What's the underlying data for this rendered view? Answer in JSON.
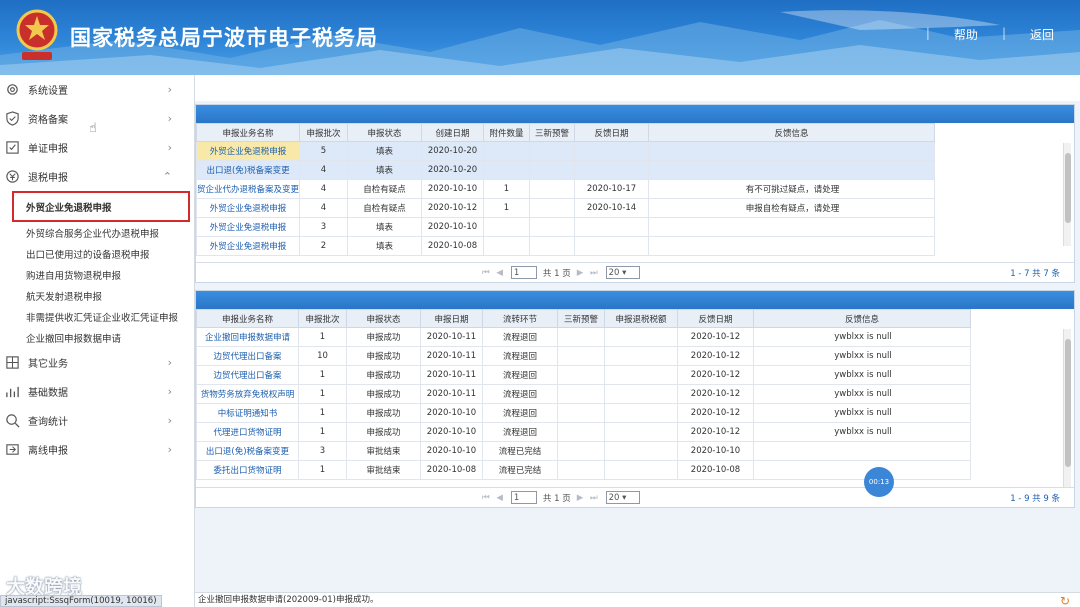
{
  "header": {
    "title": "国家税务总局宁波市电子税务局",
    "help_label": "帮助",
    "back_label": "返回",
    "separator": "|"
  },
  "sidebar": {
    "items": [
      {
        "label": "系统设置",
        "icon": "gear-icon",
        "chevron": "›"
      },
      {
        "label": "资格备案",
        "icon": "shield-icon",
        "chevron": "›"
      },
      {
        "label": "单证申报",
        "icon": "document-icon",
        "chevron": "›"
      },
      {
        "label": "退税申报",
        "icon": "refund-icon",
        "chevron": "⌃"
      }
    ],
    "sub_items": [
      "外贸企业免退税申报",
      "外贸综合服务企业代办退税申报",
      "出口已使用过的设备退税申报",
      "购进自用货物退税申报",
      "航天发射退税申报",
      "非需提供收汇凭证企业收汇凭证申报",
      "企业撤回申报数据申请"
    ],
    "items_after": [
      {
        "label": "其它业务",
        "icon": "grid-icon",
        "chevron": "›"
      },
      {
        "label": "基础数据",
        "icon": "chart-icon",
        "chevron": "›"
      },
      {
        "label": "查询统计",
        "icon": "search-icon",
        "chevron": "›"
      },
      {
        "label": "离线申报",
        "icon": "offline-icon",
        "chevron": "›"
      }
    ]
  },
  "table1": {
    "headers": [
      "申报业务名称",
      "申报批次",
      "申报状态",
      "创建日期",
      "附件数量",
      "三新预警",
      "反馈日期",
      "反馈信息"
    ],
    "rows": [
      [
        "外贸企业免退税申报",
        "5",
        "填表",
        "2020-10-20",
        "",
        "",
        "",
        ""
      ],
      [
        "出口退(免)税备案变更",
        "4",
        "填表",
        "2020-10-20",
        "",
        "",
        "",
        ""
      ],
      [
        "贸企业代办退税备案及变更",
        "4",
        "自检有疑点",
        "2020-10-10",
        "1",
        "",
        "2020-10-17",
        "有不可挑过疑点，请处理"
      ],
      [
        "外贸企业免退税申报",
        "4",
        "自检有疑点",
        "2020-10-12",
        "1",
        "",
        "2020-10-14",
        "申报自检有疑点，请处理"
      ],
      [
        "外贸企业免退税申报",
        "3",
        "填表",
        "2020-10-10",
        "",
        "",
        "",
        ""
      ],
      [
        "外贸企业免退税申报",
        "2",
        "填表",
        "2020-10-08",
        "",
        "",
        "",
        ""
      ]
    ],
    "pager": {
      "arrows_prev": "⏮ ◀",
      "page": "1",
      "of": "共 1 页",
      "arrows_next": "▶ ⏭",
      "page_size": "20",
      "total": "1 - 7  共 7 条"
    }
  },
  "table2": {
    "headers": [
      "申报业务名称",
      "申报批次",
      "申报状态",
      "申报日期",
      "流转环节",
      "三新预警",
      "申报退税税额",
      "反馈日期",
      "反馈信息"
    ],
    "rows": [
      [
        "企业撤回申报数据申请",
        "1",
        "申报成功",
        "2020-10-11",
        "流程退回",
        "",
        "",
        "2020-10-12",
        "ywblxx is null"
      ],
      [
        "边贸代理出口备案",
        "10",
        "申报成功",
        "2020-10-11",
        "流程退回",
        "",
        "",
        "2020-10-12",
        "ywblxx is null"
      ],
      [
        "边贸代理出口备案",
        "1",
        "申报成功",
        "2020-10-11",
        "流程退回",
        "",
        "",
        "2020-10-12",
        "ywblxx is null"
      ],
      [
        "货物劳务放弃免税权声明",
        "1",
        "申报成功",
        "2020-10-11",
        "流程退回",
        "",
        "",
        "2020-10-12",
        "ywblxx is null"
      ],
      [
        "中标证明通知书",
        "1",
        "申报成功",
        "2020-10-10",
        "流程退回",
        "",
        "",
        "2020-10-12",
        "ywblxx is null"
      ],
      [
        "代理进口货物证明",
        "1",
        "申报成功",
        "2020-10-10",
        "流程退回",
        "",
        "",
        "2020-10-12",
        "ywblxx is null"
      ],
      [
        "出口退(免)税备案变更",
        "3",
        "审批结束",
        "2020-10-10",
        "流程已完结",
        "",
        "",
        "2020-10-10",
        ""
      ],
      [
        "委托出口货物证明",
        "1",
        "审批结束",
        "2020-10-08",
        "流程已完结",
        "",
        "",
        "2020-10-08",
        ""
      ]
    ],
    "pager": {
      "arrows_prev": "⏮ ◀",
      "page": "1",
      "of": "共 1 页",
      "arrows_next": "▶ ⏭",
      "page_size": "20",
      "total": "1 - 9  共 9 条"
    }
  },
  "status": {
    "message": "企业撤回申报数据申请(202009-01)申报成功。",
    "url": "javascript:SssqForm(10019, 10016)",
    "watermark": "大数跨境",
    "float_button": "00:13"
  },
  "colors": {
    "header_blue": "#2f86d8",
    "active_border": "#d32b2b",
    "link": "#1d5fb0"
  }
}
